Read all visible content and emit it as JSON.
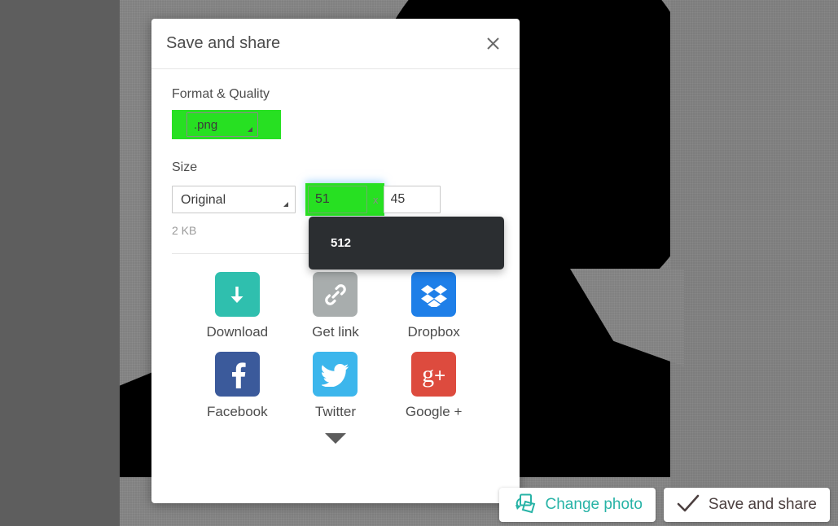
{
  "editor": {
    "canvas_background_color": "#818181",
    "backdrop_color": "#5e5e5e",
    "photo_description": "silhouette portrait"
  },
  "dialog": {
    "title": "Save and share",
    "close_icon": "close-icon",
    "format_section": {
      "label": "Format & Quality",
      "format_value": ".png",
      "highlight_color": "#27e022"
    },
    "size_section": {
      "label": "Size",
      "preset_value": "Original",
      "width_value": "51",
      "height_value": "45",
      "separator": "x",
      "file_size": "2 KB",
      "highlight_color": "#27e022"
    },
    "suggestion": {
      "items": [
        "512"
      ],
      "background_color": "#2b2e31"
    },
    "share_targets": [
      {
        "label": "Download",
        "icon": "download-arrow-icon",
        "color": "#2fbfae"
      },
      {
        "label": "Get link",
        "icon": "link-chain-icon",
        "color": "#a8adad"
      },
      {
        "label": "Dropbox",
        "icon": "dropbox-icon",
        "color": "#1e7fe8"
      },
      {
        "label": "Facebook",
        "icon": "facebook-icon",
        "color": "#3b5a9b"
      },
      {
        "label": "Twitter",
        "icon": "twitter-bird-icon",
        "color": "#3cb6ec"
      },
      {
        "label": "Google +",
        "icon": "google-plus-icon",
        "color": "#dd4b3e"
      }
    ],
    "more_icon": "chevron-down-icon"
  },
  "action_bar": {
    "change_photo": {
      "label": "Change photo",
      "icon": "swap-photos-icon",
      "color": "#27b3a6"
    },
    "save_and_share": {
      "label": "Save and share",
      "icon": "check-icon",
      "color": "#4c4040"
    }
  }
}
